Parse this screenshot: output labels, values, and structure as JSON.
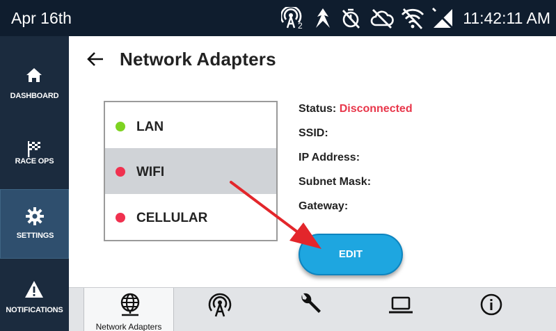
{
  "status_bar": {
    "date": "Apr 16th",
    "time": "11:42:11 AM",
    "icons": [
      "antenna-2-icon",
      "nav-arrow-icon",
      "timer-off-icon",
      "cloud-off-icon",
      "wifi-off-icon",
      "signal-off-icon"
    ],
    "antenna_sub": "2"
  },
  "sidebar": {
    "items": [
      {
        "label": "DASHBOARD",
        "icon": "home-icon",
        "active": false
      },
      {
        "label": "RACE OPS",
        "icon": "checkered-flag-icon",
        "active": false
      },
      {
        "label": "SETTINGS",
        "icon": "gear-icon",
        "active": true
      },
      {
        "label": "NOTIFICATIONS",
        "icon": "warning-icon",
        "active": false
      }
    ]
  },
  "header": {
    "title": "Network Adapters"
  },
  "adapters": [
    {
      "label": "LAN",
      "status_color": "#7ed321",
      "selected": false
    },
    {
      "label": "WIFI",
      "status_color": "#f0314f",
      "selected": true
    },
    {
      "label": "CELLULAR",
      "status_color": "#f0314f",
      "selected": false
    }
  ],
  "details": {
    "status_label": "Status:",
    "status_value": "Disconnected",
    "ssid_label": "SSID:",
    "ip_label": "IP Address:",
    "subnet_label": "Subnet Mask:",
    "gateway_label": "Gateway:"
  },
  "edit_button": {
    "label": "EDIT"
  },
  "tabs": [
    {
      "label": "Network Adapters",
      "icon": "globe-network-icon",
      "active": true
    },
    {
      "label": "",
      "icon": "antenna-icon",
      "active": false
    },
    {
      "label": "",
      "icon": "wrench-icon",
      "active": false
    },
    {
      "label": "",
      "icon": "laptop-icon",
      "active": false
    },
    {
      "label": "",
      "icon": "info-icon",
      "active": false
    }
  ],
  "colors": {
    "status_bar_bg": "#0f1d2e",
    "sidebar_bg": "#1b2b3e",
    "sidebar_active_bg": "#2f4f6e",
    "accent_blue": "#1ea6e0",
    "error_red": "#e8364a",
    "ok_green": "#7ed321",
    "annotation_arrow": "#e3262b"
  }
}
